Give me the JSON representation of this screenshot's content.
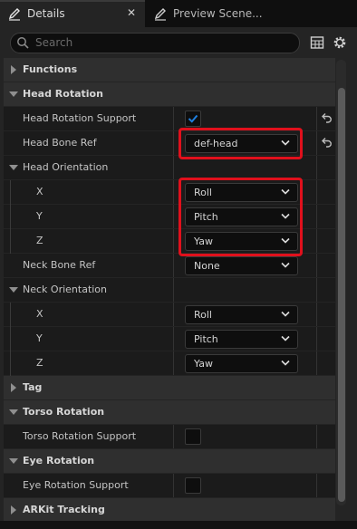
{
  "tabs": [
    {
      "label": "Details",
      "icon": "pencil-icon",
      "active": true
    },
    {
      "label": "Preview Scene...",
      "icon": "pencil-icon",
      "active": false
    }
  ],
  "tab_close_glyph": "✕",
  "search": {
    "placeholder": "Search",
    "value": ""
  },
  "toolbar": {
    "view_icon": "table-icon",
    "settings_icon": "gear-icon"
  },
  "categories": {
    "functions": "Functions",
    "head_rotation": "Head Rotation",
    "tag": "Tag",
    "torso_rotation": "Torso Rotation",
    "eye_rotation": "Eye Rotation",
    "arkit_tracking": "ARKit Tracking"
  },
  "head_rotation": {
    "support_label": "Head Rotation Support",
    "support_checked": true,
    "head_bone_label": "Head Bone Ref",
    "head_bone_value": "def-head",
    "head_orientation_label": "Head Orientation",
    "head_orientation": {
      "x_label": "X",
      "x_value": "Roll",
      "y_label": "Y",
      "y_value": "Pitch",
      "z_label": "Z",
      "z_value": "Yaw"
    },
    "neck_bone_label": "Neck Bone Ref",
    "neck_bone_value": "None",
    "neck_orientation_label": "Neck Orientation",
    "neck_orientation": {
      "x_label": "X",
      "x_value": "Roll",
      "y_label": "Y",
      "y_value": "Pitch",
      "z_label": "Z",
      "z_value": "Yaw"
    }
  },
  "torso_rotation": {
    "support_label": "Torso Rotation Support",
    "support_checked": false
  },
  "eye_rotation": {
    "support_label": "Eye Rotation Support",
    "support_checked": false
  },
  "colors": {
    "background": "#242424",
    "accent": "#1f80e0",
    "highlight": "#e0101c"
  }
}
